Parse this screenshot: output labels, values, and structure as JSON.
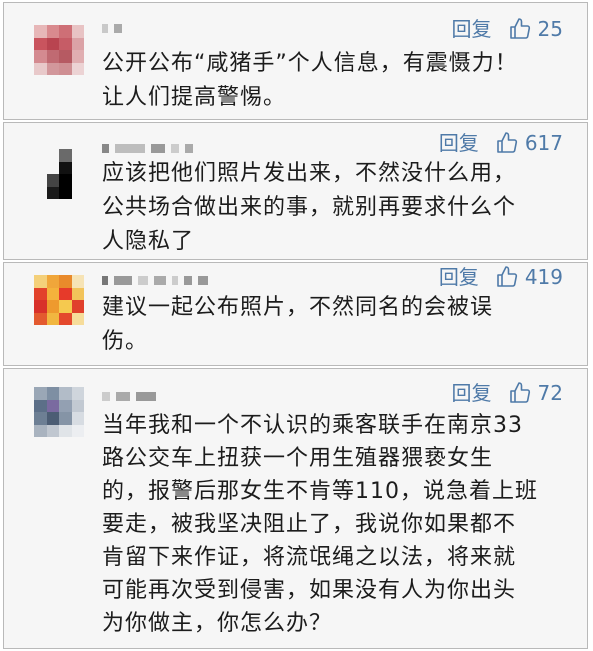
{
  "colors": {
    "card_bg": "#f6f6f6",
    "border": "#b9b9b9",
    "action": "#4f7aa8",
    "text": "#1c1c1c"
  },
  "comments": [
    {
      "reply_label": "回复",
      "like_icon": "thumbs-up-icon",
      "likes": "25",
      "text": "公开公布“咸猪手”个人信息，有震慑力！\n让人们提高警惕。"
    },
    {
      "reply_label": "回复",
      "like_icon": "thumbs-up-icon",
      "likes": "617",
      "text": "应该把他们照片发出来，不然没什么用，\n公共场合做出来的事，就别再要求什么个\n人隐私了"
    },
    {
      "reply_label": "回复",
      "like_icon": "thumbs-up-icon",
      "likes": "419",
      "text": "建议一起公布照片，不然同名的会被误\n伤。"
    },
    {
      "reply_label": "回复",
      "like_icon": "thumbs-up-icon",
      "likes": "72",
      "text": "当年我和一个不认识的乘客联手在南京33\n路公交车上扭获一个用生殖器猥亵女生\n的，报警后那女生不肯等110，说急着上班\n要走，被我坚决阻止了，我说你如果都不\n肯留下来作证，将流氓绳之以法，将来就\n可能再次受到侵害，如果没有人为你出头\n为你做主，你怎么办？"
    }
  ]
}
